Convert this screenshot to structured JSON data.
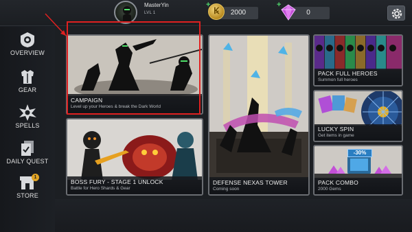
{
  "player": {
    "name": "MasterYin",
    "level": "LVL 1"
  },
  "currency": {
    "gold": "2000",
    "gems": "0"
  },
  "sidebar": {
    "items": [
      {
        "label": "OVERVIEW"
      },
      {
        "label": "GEAR"
      },
      {
        "label": "SPELLS"
      },
      {
        "label": "DAILY QUEST"
      },
      {
        "label": "STORE",
        "badge": "1"
      }
    ]
  },
  "cards": {
    "campaign": {
      "title": "CAMPAIGN",
      "subtitle": "Level up your Heroes & break the Dark World"
    },
    "boss_fury": {
      "title": "BOSS FURY - STAGE 1 UNLOCK",
      "subtitle": "Battle for Hero Shards & Gear"
    },
    "defense": {
      "title": "DEFENSE NEXAS TOWER",
      "subtitle": "Coming soon"
    },
    "pack_heroes": {
      "title": "PACK FULL HEROES",
      "subtitle": "Summon full heroes"
    },
    "lucky_spin": {
      "title": "LUCKY SPIN",
      "subtitle": "Get items in game"
    },
    "pack_combo": {
      "title": "PACK COMBO",
      "subtitle": "2000 Gems",
      "discount": "-30%"
    }
  },
  "colors": {
    "highlight": "#e02020",
    "card_border": "#6a6d72",
    "gold": "#e6c35a",
    "gem": "#c24fd6"
  }
}
